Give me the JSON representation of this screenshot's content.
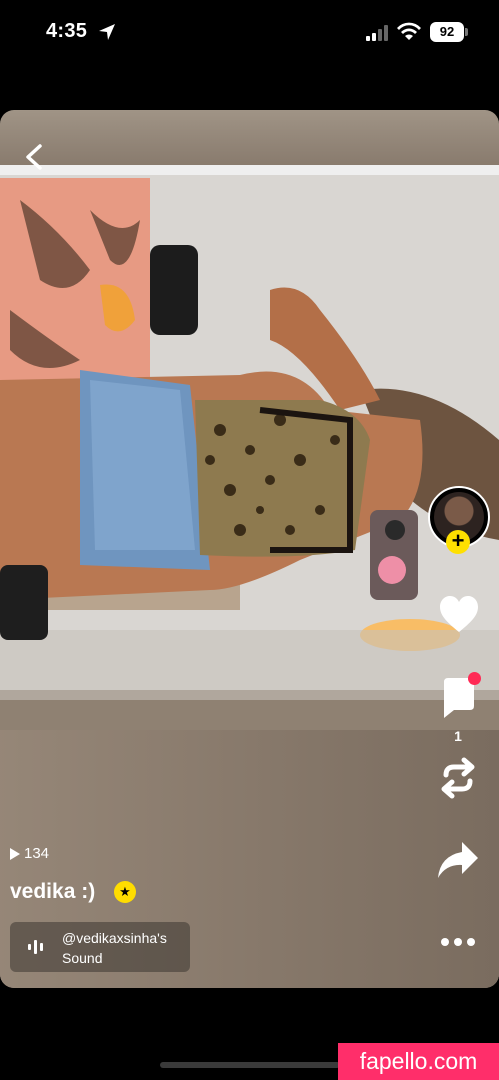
{
  "status_bar": {
    "time": "4:35",
    "battery": "92"
  },
  "post": {
    "views": "134",
    "username": "vedika :)",
    "comment_count": "1"
  },
  "sound": {
    "line1": "@vedikaxsinha's",
    "line2": "Sound"
  },
  "watermark": "fapello.com",
  "colors": {
    "follow_badge": "#ffe000",
    "notification_dot": "#ff2a55",
    "watermark_bg": "#ff2e6a"
  }
}
